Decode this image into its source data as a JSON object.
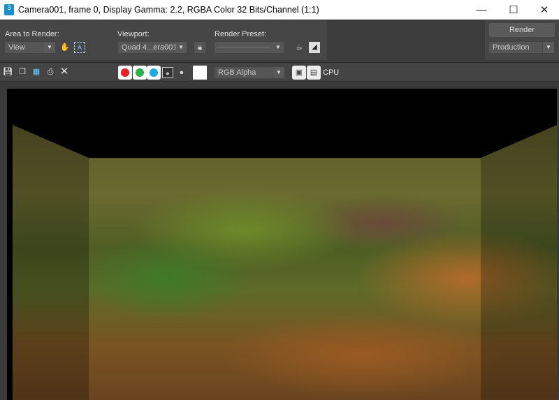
{
  "window": {
    "title": "Camera001, frame 0, Display Gamma: 2.2, RGBA Color 32 Bits/Channel (1:1)",
    "app_icon": "3",
    "minimize": "—",
    "maximize": "☐",
    "close": "✕"
  },
  "panel": {
    "area_label": "Area to Render:",
    "area_value": "View",
    "viewport_label": "Viewport:",
    "viewport_value": "Quad 4...era001",
    "preset_label": "Render Preset:",
    "preset_value": "",
    "render_button": "Render",
    "render_mode": "Production"
  },
  "toolbar": {
    "channel_display": "RGB Alpha",
    "cpu_label": "CPU",
    "colors": {
      "red": "#e8202a",
      "green": "#2db34a",
      "blue": "#1ea8e0"
    }
  }
}
